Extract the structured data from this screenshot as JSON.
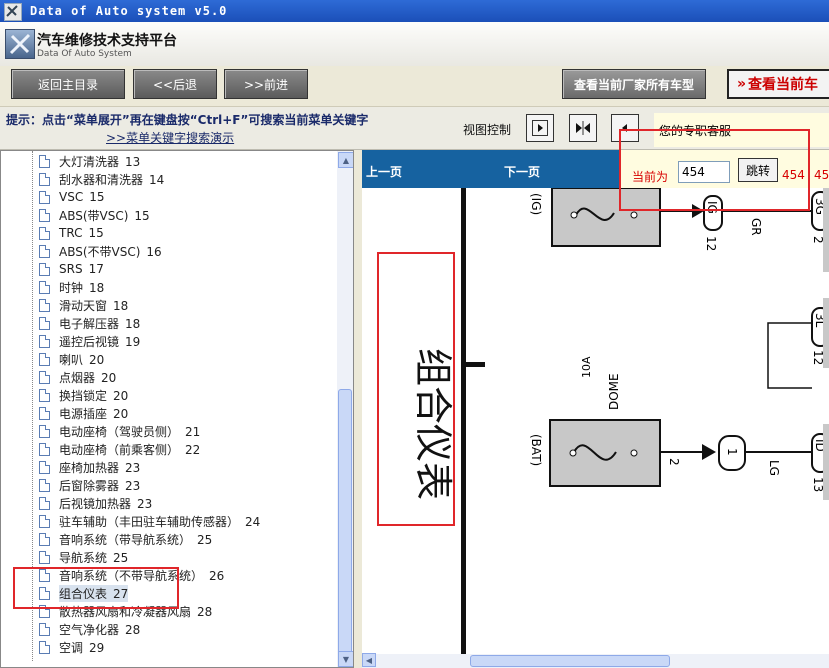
{
  "window": {
    "title": "Data of Auto system v5.0"
  },
  "header": {
    "brand": "汽车维修技术支持平台",
    "subtitle": "Data Of Auto System"
  },
  "nav": {
    "home": "返回主目录",
    "back": "<<后退",
    "forward": ">>前进",
    "all_models": "查看当前厂家所有车型",
    "current_model": "查看当前车"
  },
  "hint": {
    "text": "提示：点击“菜单展开”再在键盘按“Ctrl+F”可搜索当前菜单关键字",
    "link": ">>菜单关键字搜索演示",
    "view_control": "视图控制",
    "support": "您的专职客服"
  },
  "tree": {
    "items": [
      {
        "label": "大灯清洗器",
        "num": "13"
      },
      {
        "label": "刮水器和清洗器",
        "num": "14"
      },
      {
        "label": "VSC",
        "num": "15"
      },
      {
        "label": "ABS(带VSC)",
        "num": "15"
      },
      {
        "label": "TRC",
        "num": "15"
      },
      {
        "label": "ABS(不带VSC)",
        "num": "16"
      },
      {
        "label": "SRS",
        "num": "17"
      },
      {
        "label": "时钟",
        "num": "18"
      },
      {
        "label": "滑动天窗",
        "num": "18"
      },
      {
        "label": "电子解压器",
        "num": "18"
      },
      {
        "label": "遥控后视镜",
        "num": "19"
      },
      {
        "label": "喇叭",
        "num": "20"
      },
      {
        "label": "点烟器",
        "num": "20"
      },
      {
        "label": "换挡锁定",
        "num": "20"
      },
      {
        "label": "电源插座",
        "num": "20"
      },
      {
        "label": "电动座椅（驾驶员侧）",
        "num": "21"
      },
      {
        "label": "电动座椅（前乘客侧）",
        "num": "22"
      },
      {
        "label": "座椅加热器",
        "num": "23"
      },
      {
        "label": "后窗除雾器",
        "num": "23"
      },
      {
        "label": "后视镜加热器",
        "num": "23"
      },
      {
        "label": "驻车辅助（丰田驻车辅助传感器）",
        "num": "24"
      },
      {
        "label": "音响系统（带导航系统）",
        "num": "25"
      },
      {
        "label": "导航系统",
        "num": "25"
      },
      {
        "label": "音响系统（不带导航系统）",
        "num": "26"
      },
      {
        "label": "组合仪表",
        "num": "27"
      },
      {
        "label": "散热器风扇和冷凝器风扇",
        "num": "28"
      },
      {
        "label": "空气净化器",
        "num": "28"
      },
      {
        "label": "空调",
        "num": "29"
      }
    ],
    "selected_index": 24
  },
  "pager": {
    "prev": "上一页",
    "next": "下一页",
    "current_label": "当前为",
    "page_value": "454",
    "jump": "跳转",
    "total_a": "454",
    "total_b": "45"
  },
  "diagram": {
    "title": "组合仪表",
    "ig": "(IG)",
    "bat": "(BAT)",
    "fuse_amp": "10A",
    "fuse_name": "DOME",
    "wire_gr": "GR",
    "wire_lg": "LG",
    "pin_2": "2",
    "pin_12a": "12",
    "pin_12b": "12",
    "pin_2b": "2",
    "pin_13": "13",
    "conn_1": "1",
    "conn_ig": "IG",
    "conn_3g": "3G",
    "conn_3l": "3L",
    "conn_id": "ID"
  }
}
